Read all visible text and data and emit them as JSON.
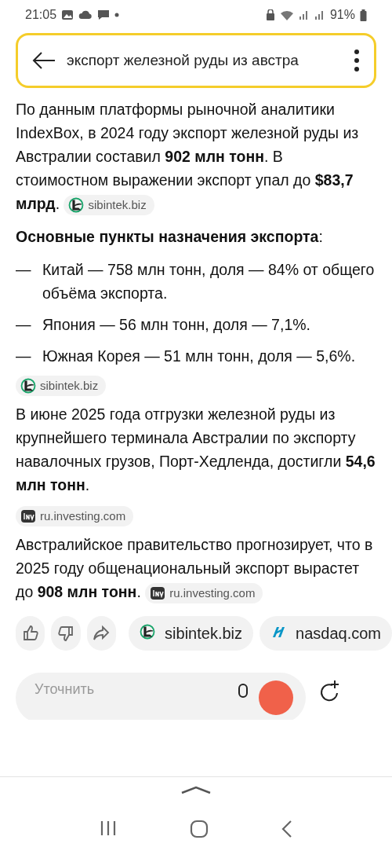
{
  "status_bar": {
    "time": "21:05",
    "battery": "91%"
  },
  "search_bar": {
    "query": "экспорт железной руды из австра"
  },
  "answer": [
    {
      "kind": "paragraph",
      "text": "По данным платформы рыночной аналитики IndexBox, в 2024 году экспорт железной руды из Австралии составил **902 млн тонн**. В стоимостном выражении экспорт упал до **$83,7 млрд**.",
      "source": {
        "kind": "sibintek",
        "label": "sibintek.biz"
      }
    },
    {
      "kind": "paragraph",
      "text": "**Основные пункты назначения экспорта**:"
    },
    {
      "kind": "list",
      "items": [
        {
          "dash": "—",
          "text": "Китай — 758 млн тонн, доля — 84% от общего объёма экспорта."
        },
        {
          "dash": "—",
          "text": "Япония — 56 млн тонн, доля — 7,1%."
        },
        {
          "dash": "—",
          "text": "Южная Корея — 51 млн тонн, доля — 5,6%."
        }
      ]
    },
    {
      "kind": "source",
      "source": {
        "kind": "sibintek",
        "label": "sibintek.biz"
      }
    },
    {
      "kind": "paragraph",
      "text": "В июне 2025 года отгрузки железной руды из крупнейшего терминала Австралии по экспорту навалочных грузов, Порт-Хедленда, достигли **54,6 млн тонн**."
    },
    {
      "kind": "source",
      "source": {
        "kind": "investing",
        "label": "ru.investing.com"
      }
    },
    {
      "kind": "paragraph",
      "text": "Австралийское правительство прогнозирует, что в 2025 году общенациональный экспорт вырастет до **908 млн тонн**.",
      "source": {
        "kind": "investing",
        "label": "ru.investing.com"
      }
    }
  ],
  "actions": [
    {
      "kind": "like"
    },
    {
      "kind": "dislike"
    },
    {
      "kind": "share"
    }
  ],
  "sources": [
    {
      "kind": "sibintek",
      "label": "sibintek.biz"
    },
    {
      "kind": "nasdaq",
      "label": "nasdaq.com"
    }
  ],
  "composer": {
    "placeholder": "Уточнить"
  }
}
